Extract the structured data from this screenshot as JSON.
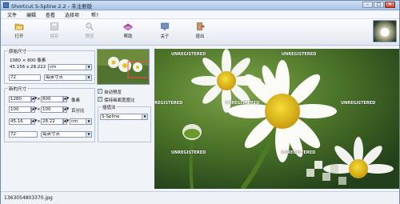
{
  "window": {
    "title": "Shortcut S-Spline 2.2 - 未注册版",
    "controls": {
      "minimize": "–",
      "maximize": "□",
      "close": "✕"
    }
  },
  "menu": [
    "文件",
    "编辑",
    "查看",
    "选择项",
    "帮?"
  ],
  "toolbar": {
    "open": "打开",
    "save": "保存",
    "preview": "预览",
    "help": "帮助",
    "about": "关于",
    "exit": "退出"
  },
  "original_size": {
    "legend": "原始尺寸",
    "pixels": "1080 × 800 像素",
    "dimensions": "45.156 x 28.222",
    "unit": "cm",
    "dpi": "72",
    "dpi_unit": "每英寸点"
  },
  "new_size": {
    "legend": "新的尺寸",
    "width_px": "1280",
    "height_px": "800",
    "pixel_unit": "像素",
    "width_pct": "100",
    "height_pct": "100",
    "pct_unit": "百分比",
    "width_cm": "45.16",
    "height_cm": "28.22",
    "cm_unit": "cm",
    "dpi": "72",
    "dpi_unit": "每英寸点"
  },
  "options": {
    "auto_preview": "自动预览",
    "keep_ratio": "保持画面宽度比",
    "interp_legend": "插值法",
    "interp_value": "S-Spline"
  },
  "watermark": "UNREGISTERED",
  "status": {
    "filename": "1363054803370.jpg"
  },
  "colors": {
    "accent": "#4a7bb8",
    "title_bar": "#a9c4e6"
  }
}
